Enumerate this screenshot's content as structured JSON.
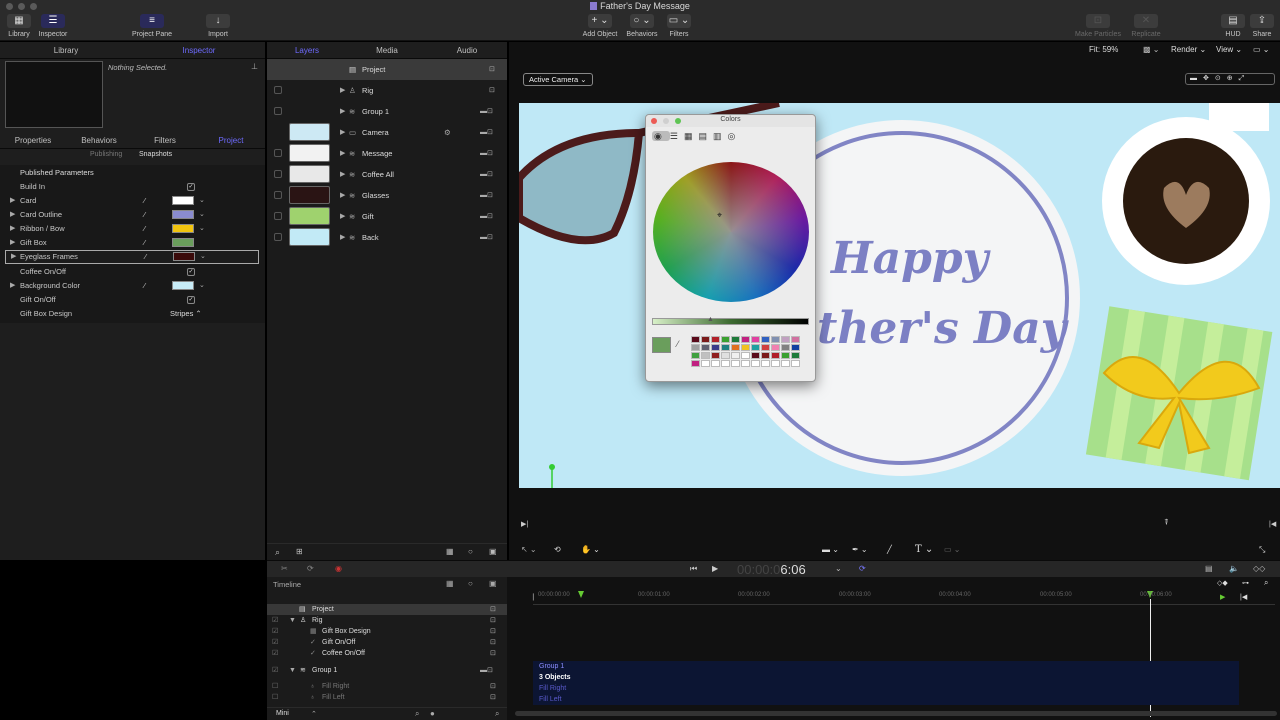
{
  "window": {
    "title": "Father's Day Message"
  },
  "toolbar": {
    "library": "Library",
    "inspector": "Inspector",
    "project_pane": "Project Pane",
    "import": "Import",
    "add_object": "Add Object",
    "behaviors": "Behaviors",
    "filters": "Filters",
    "make_particles": "Make Particles",
    "replicate": "Replicate",
    "hud": "HUD",
    "share": "Share"
  },
  "left_tabs": {
    "library": "Library",
    "inspector": "Inspector"
  },
  "preview": {
    "status": "Nothing Selected."
  },
  "inspector_tabs": [
    "Properties",
    "Behaviors",
    "Filters",
    "Project"
  ],
  "sub_tabs": {
    "publishing": "Publishing",
    "snapshots": "Snapshots"
  },
  "published_parameters": {
    "title": "Published Parameters",
    "rows": [
      {
        "label": "Build In",
        "kind": "check"
      },
      {
        "label": "Card",
        "kind": "color",
        "color": "#ffffff"
      },
      {
        "label": "Card Outline",
        "kind": "color",
        "color": "#8a8ccf"
      },
      {
        "label": "Ribbon / Bow",
        "kind": "color",
        "color": "#f1c40f"
      },
      {
        "label": "Gift Box",
        "kind": "color",
        "color": "#6a9e5c"
      },
      {
        "label": "Eyeglass Frames",
        "kind": "color",
        "color": "#3a0a0a"
      },
      {
        "label": "Coffee On/Off",
        "kind": "check"
      },
      {
        "label": "Background Color",
        "kind": "color",
        "color": "#c8ecf7"
      },
      {
        "label": "Gift On/Off",
        "kind": "check"
      },
      {
        "label": "Gift Box Design",
        "kind": "popup",
        "value": "Stripes"
      }
    ]
  },
  "mid_tabs": {
    "layers": "Layers",
    "media": "Media",
    "audio": "Audio"
  },
  "layers": [
    {
      "name": "Project"
    },
    {
      "name": "Rig"
    },
    {
      "name": "Group 1"
    },
    {
      "name": "Camera"
    },
    {
      "name": "Message"
    },
    {
      "name": "Coffee All"
    },
    {
      "name": "Glasses"
    },
    {
      "name": "Gift"
    },
    {
      "name": "Back"
    }
  ],
  "canvas": {
    "fit": "Fit: 59%",
    "render": "Render",
    "view": "View",
    "camera": "Active Camera",
    "headline1": "Happy",
    "headline2": "ther's Day"
  },
  "colors_panel": {
    "title": "Colors",
    "current_color": "#6a9e5c"
  },
  "transport": {
    "timecode_dim": "00:00:0",
    "timecode": "6:06"
  },
  "timeline": {
    "label": "Timeline",
    "rows": [
      "Project",
      "Rig",
      "Gift Box Design",
      "Gift On/Off",
      "Coffee On/Off",
      "Group 1",
      "Fill Right",
      "Fill Left"
    ],
    "ruler": [
      "00:00:00:00",
      "00:00:01:00",
      "00:00:02:00",
      "00:00:03:00",
      "00:00:04:00",
      "00:00:05:00",
      "00:00:06:00"
    ],
    "track_labels": [
      "Group 1",
      "3 Objects",
      "Fill Right",
      "Fill Left"
    ],
    "mini": "Mini"
  },
  "colors": {
    "accent": "#6e6bff",
    "panel": "#1e1e1e",
    "canvas_bg": "#bfe8f6",
    "headline": "#7c80c4",
    "playhead": "#ffffff"
  }
}
